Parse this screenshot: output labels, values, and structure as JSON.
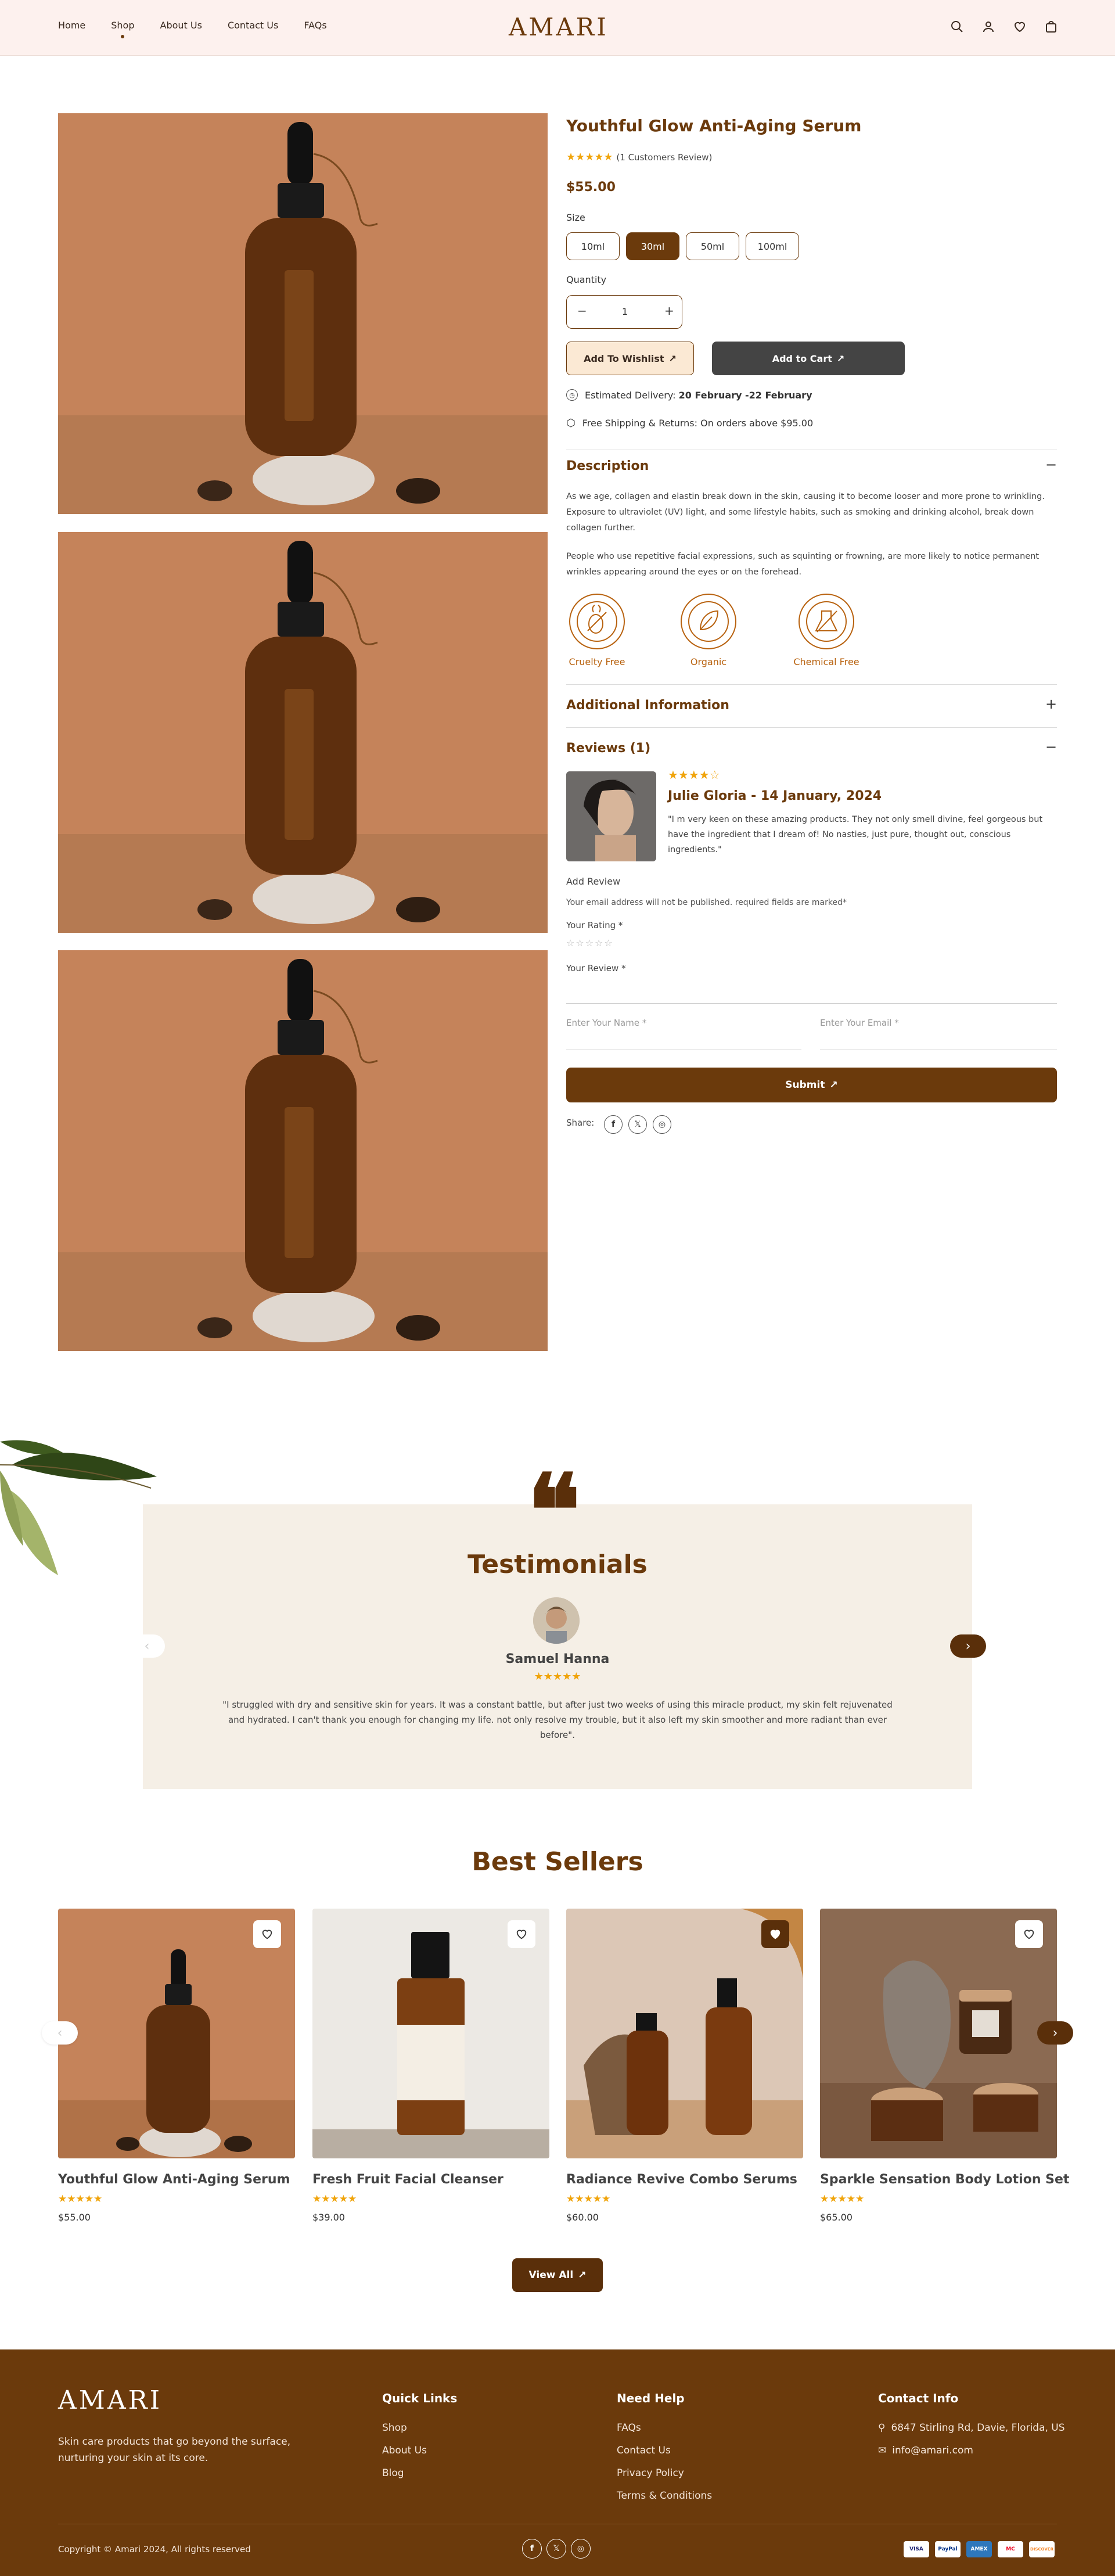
{
  "header": {
    "nav": [
      "Home",
      "Shop",
      "About Us",
      "Contact Us",
      "FAQs"
    ],
    "logo": "AMARI"
  },
  "product": {
    "title": "Youthful Glow Anti-Aging Serum",
    "rating": 5,
    "reviews_text": "(1 Customers Review)",
    "price": "$55.00",
    "size_label": "Size",
    "sizes": [
      "10ml",
      "30ml",
      "50ml",
      "100ml"
    ],
    "selected_size": "30ml",
    "quantity_label": "Quantity",
    "quantity": "1",
    "wishlist_label": "Add To Wishlist",
    "cart_label": "Add to Cart",
    "delivery_prefix": "Estimated Delivery: ",
    "delivery_dates": "20 February -22 February",
    "shipping": "Free Shipping & Returns: On orders above $95.00",
    "description_title": "Description",
    "description_p1": "As we age, collagen and elastin break down in the skin, causing it to become looser and more prone to wrinkling. Exposure to ultraviolet (UV) light, and some lifestyle habits, such as smoking and drinking alcohol, break down collagen further.",
    "description_p2": "People who use repetitive facial expressions, such as squinting or frowning, are more likely to notice permanent wrinkles appearing around the eyes or on the forehead.",
    "badges": [
      "Cruelty Free",
      "Organic",
      "Chemical Free"
    ],
    "additional_title": "Additional Information",
    "reviews_title": "Reviews (1)",
    "review": {
      "rating": 4,
      "author": "Julie Gloria - 14 January, 2024",
      "text": "\"I m very keen on these amazing products. They not only smell divine, feel gorgeous but have the ingredient that I dream of! No nasties, just pure, thought out, conscious ingredients.\""
    },
    "add_review": "Add Review",
    "email_note": "Your email address will not be published. required fields are marked*",
    "your_rating": "Your Rating *",
    "your_review": "Your Review *",
    "name_placeholder": "Enter Your Name *",
    "email_placeholder": "Enter Your Email *",
    "submit_label": "Submit",
    "share_label": "Share:"
  },
  "testimonials": {
    "title": "Testimonials",
    "name": "Samuel Hanna",
    "rating": 5,
    "quote": "\"I struggled with dry and sensitive skin for years. It was a constant battle, but after just two weeks of using this miracle product, my skin felt rejuvenated and hydrated. I can't thank you enough for changing my life. not only resolve my trouble, but it also left my skin smoother and more radiant than ever before\"."
  },
  "best_sellers": {
    "title": "Best Sellers",
    "products": [
      {
        "name": "Youthful Glow Anti-Aging Serum",
        "price": "$55.00",
        "rating": 5
      },
      {
        "name": "Fresh Fruit Facial Cleanser",
        "price": "$39.00",
        "rating": 5
      },
      {
        "name": "Radiance Revive Combo Serums",
        "price": "$60.00",
        "rating": 5
      },
      {
        "name": "Sparkle Sensation Body Lotion Set",
        "price": "$65.00",
        "rating": 5
      }
    ],
    "view_all": "View All"
  },
  "footer": {
    "logo": "AMARI",
    "tagline": "Skin care products that go beyond the surface, nurturing your skin at its core.",
    "quick_links_title": "Quick Links",
    "quick_links": [
      "Shop",
      "About Us",
      "Blog"
    ],
    "help_title": "Need Help",
    "help_links": [
      "FAQs",
      "Contact Us",
      "Privacy Policy",
      "Terms & Conditions"
    ],
    "contact_title": "Contact Info",
    "address": "6847 Stirling Rd, Davie, Florida, US",
    "email": "info@amari.com",
    "copyright": "Copyright © Amari 2024, All rights reserved",
    "payments": [
      "VISA",
      "PayPal",
      "AMEX",
      "MC",
      "DISCOVER"
    ]
  },
  "colors": {
    "brand": "#6b3a0c",
    "star": "#f0a40b",
    "header_bg": "#fdf1ee",
    "testimonial_bg": "#f5efe6"
  }
}
